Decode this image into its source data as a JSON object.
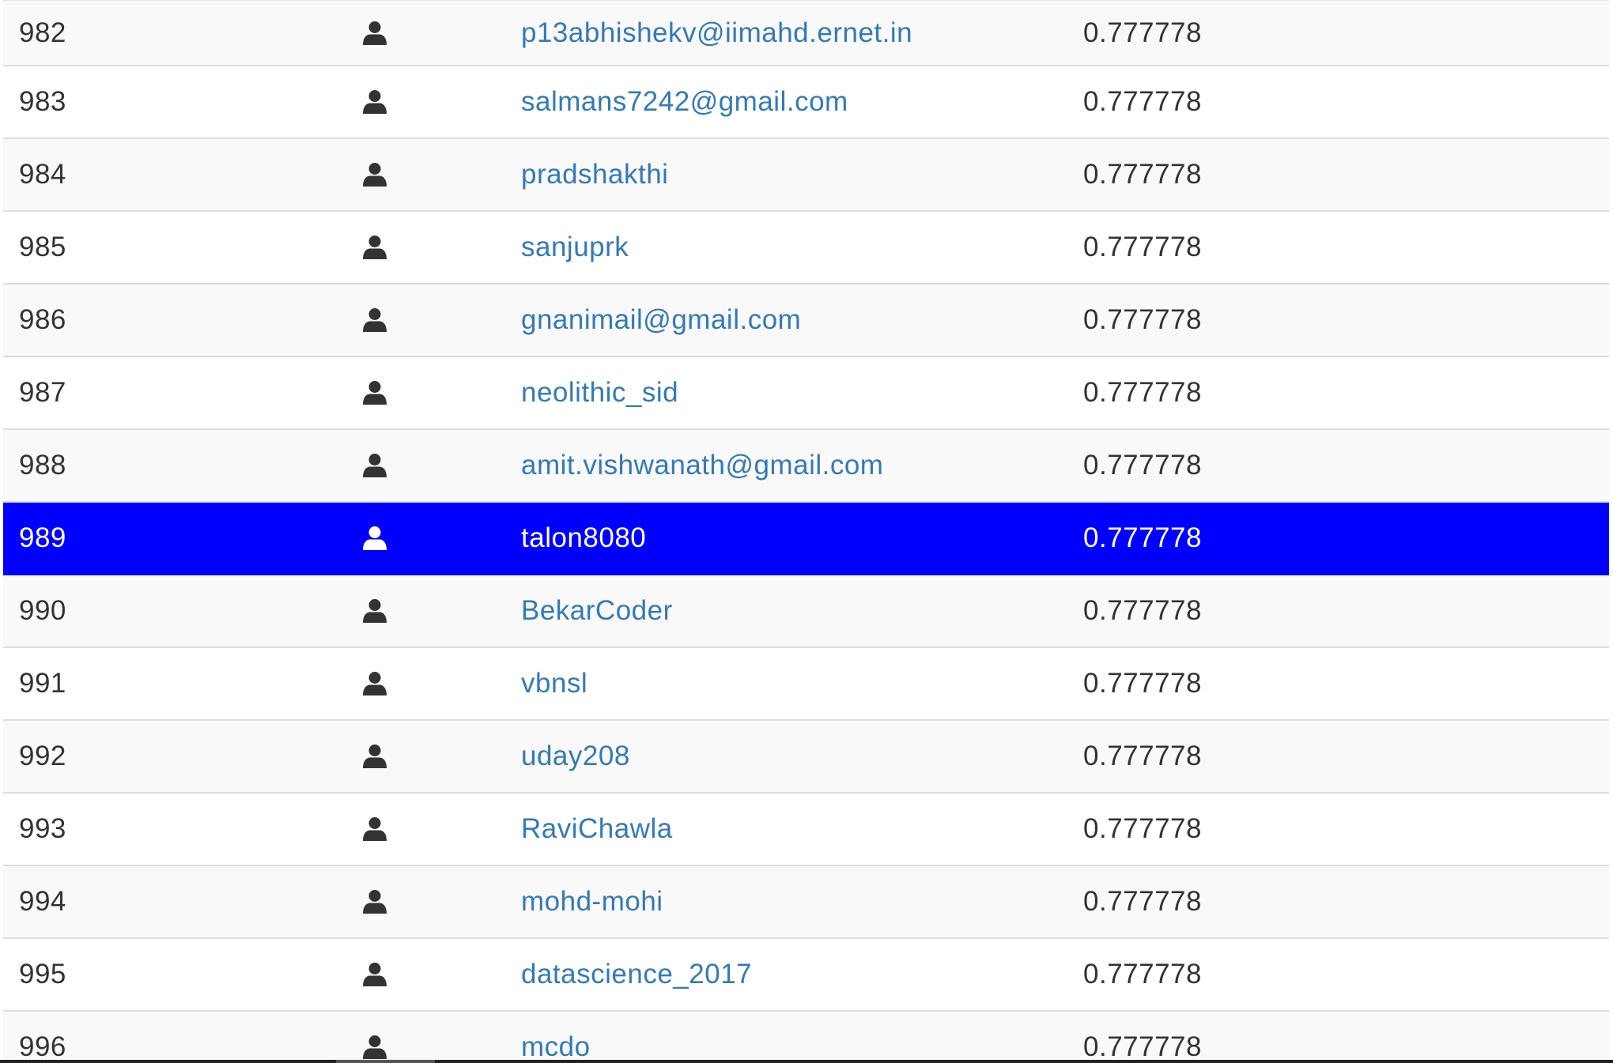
{
  "leaderboard": {
    "rows": [
      {
        "rank": "982",
        "icon": "user-icon",
        "name": "p13abhishekv@iimahd.ernet.in",
        "score": "0.777778",
        "highlighted": false
      },
      {
        "rank": "983",
        "icon": "user-icon",
        "name": "salmans7242@gmail.com",
        "score": "0.777778",
        "highlighted": false
      },
      {
        "rank": "984",
        "icon": "user-icon",
        "name": "pradshakthi",
        "score": "0.777778",
        "highlighted": false
      },
      {
        "rank": "985",
        "icon": "user-icon",
        "name": "sanjuprk",
        "score": "0.777778",
        "highlighted": false
      },
      {
        "rank": "986",
        "icon": "user-icon",
        "name": "gnanimail@gmail.com",
        "score": "0.777778",
        "highlighted": false
      },
      {
        "rank": "987",
        "icon": "user-icon",
        "name": "neolithic_sid",
        "score": "0.777778",
        "highlighted": false
      },
      {
        "rank": "988",
        "icon": "user-icon",
        "name": "amit.vishwanath@gmail.com",
        "score": "0.777778",
        "highlighted": false
      },
      {
        "rank": "989",
        "icon": "user-icon",
        "name": "talon8080",
        "score": "0.777778",
        "highlighted": true
      },
      {
        "rank": "990",
        "icon": "user-icon",
        "name": "BekarCoder",
        "score": "0.777778",
        "highlighted": false
      },
      {
        "rank": "991",
        "icon": "user-icon",
        "name": "vbnsl",
        "score": "0.777778",
        "highlighted": false
      },
      {
        "rank": "992",
        "icon": "user-icon",
        "name": "uday208",
        "score": "0.777778",
        "highlighted": false
      },
      {
        "rank": "993",
        "icon": "user-icon",
        "name": "RaviChawla",
        "score": "0.777778",
        "highlighted": false
      },
      {
        "rank": "994",
        "icon": "user-icon",
        "name": "mohd-mohi",
        "score": "0.777778",
        "highlighted": false
      },
      {
        "rank": "995",
        "icon": "user-icon",
        "name": "datascience_2017",
        "score": "0.777778",
        "highlighted": false
      },
      {
        "rank": "996",
        "icon": "user-icon",
        "name": "mcdo",
        "score": "0.777778",
        "highlighted": false
      }
    ]
  },
  "colors": {
    "link": "#337ab7",
    "text": "#333333",
    "highlight_background": "#0000ff",
    "highlight_text": "#ffffff",
    "stripe": "#f9f9f9",
    "border": "#dddddd"
  }
}
